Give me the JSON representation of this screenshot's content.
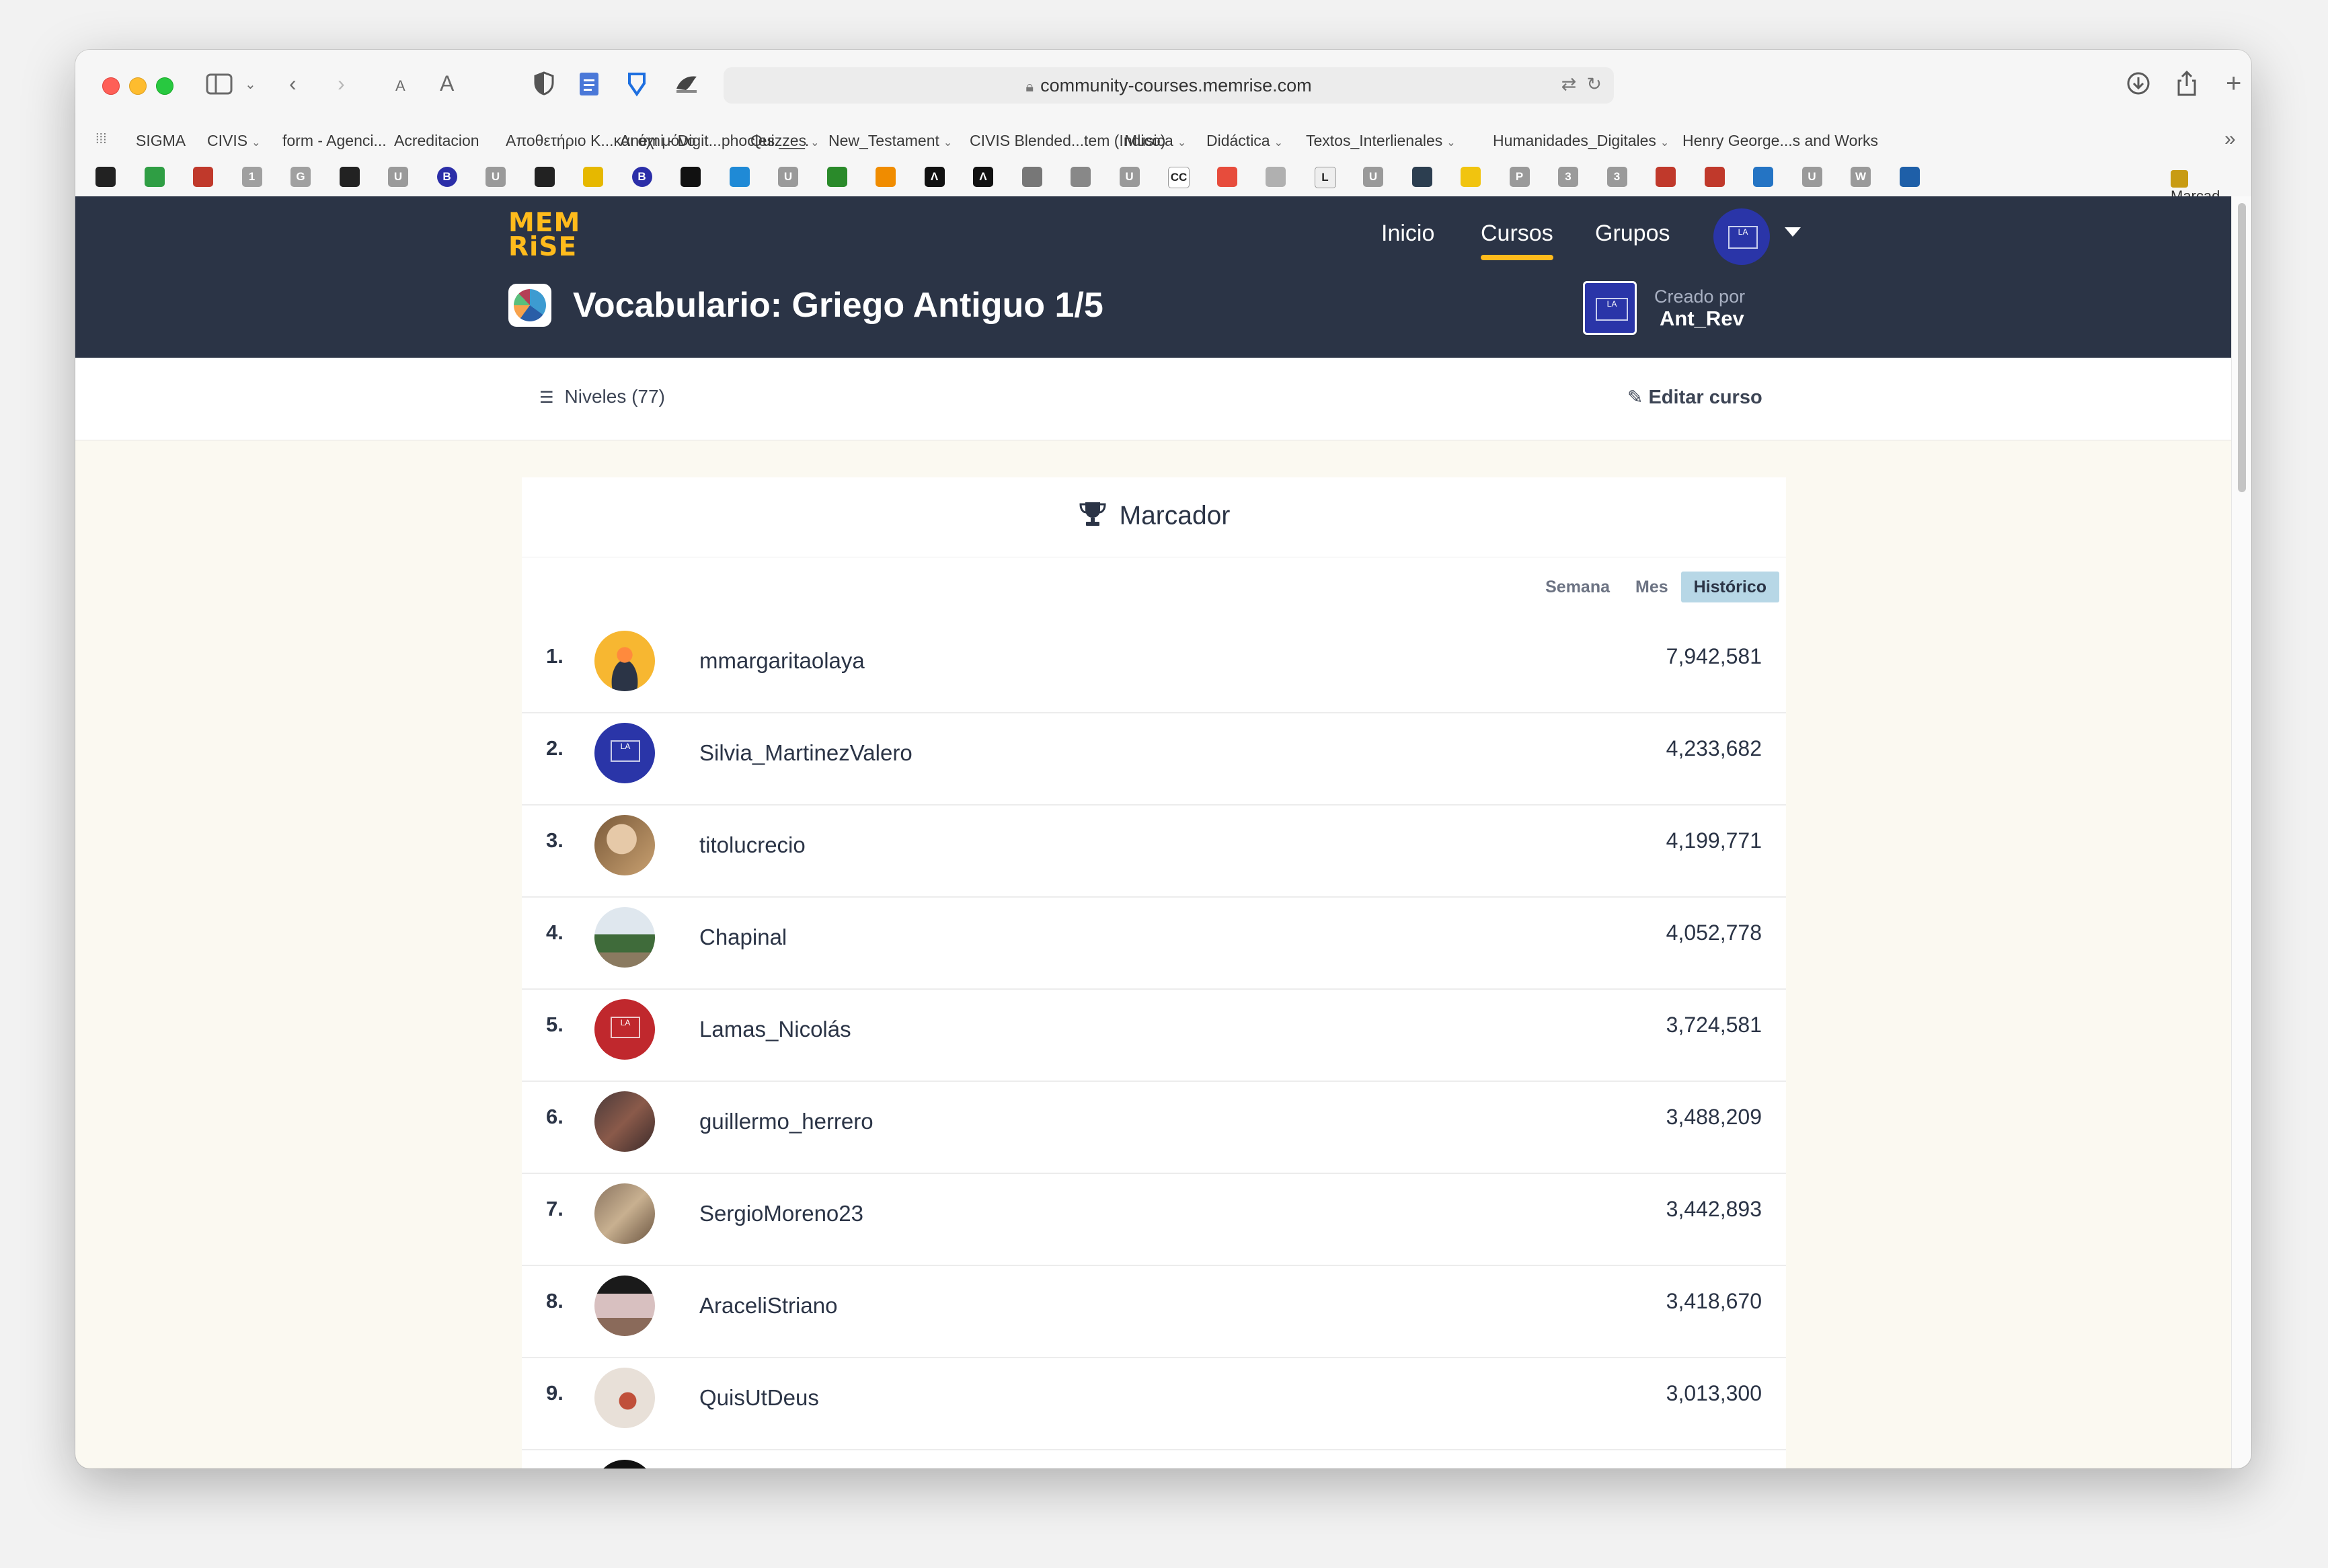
{
  "browser": {
    "url": "community-courses.memrise.com",
    "favorites": [
      {
        "label": "SIGMA",
        "has_menu": false
      },
      {
        "label": "CIVIS",
        "has_menu": true
      },
      {
        "label": "form - Agenci...",
        "has_menu": false
      },
      {
        "label": "Acreditacion",
        "has_menu": false
      },
      {
        "label": "Αποθετήριο Κ...και όχι μόνο",
        "has_menu": false
      },
      {
        "label": "Anemi - Digit...phocles ___.",
        "has_menu": false
      },
      {
        "label": "Quizzes",
        "has_menu": true
      },
      {
        "label": "New_Testament",
        "has_menu": true
      },
      {
        "label": "CIVIS Blended...tem (Indico)",
        "has_menu": false
      },
      {
        "label": "Musica",
        "has_menu": true
      },
      {
        "label": "Didáctica",
        "has_menu": true
      },
      {
        "label": "Textos_Interlienales",
        "has_menu": true
      },
      {
        "label": "Humanidades_Digitales",
        "has_menu": true
      },
      {
        "label": "Henry George...s and Works",
        "has_menu": false
      }
    ],
    "icon_bookmarks": [
      "1",
      "G",
      "U",
      "B",
      "U",
      "B",
      "U",
      "Λ",
      "Λ",
      "U",
      "CC",
      "L",
      "U",
      "P",
      "3",
      "3",
      "U",
      "W"
    ],
    "last_bookmark": "Marcad..."
  },
  "nav": {
    "logo_line1": "MEM",
    "logo_line2": "RiSE",
    "items": [
      "Inicio",
      "Cursos",
      "Grupos"
    ],
    "active": "Cursos",
    "avatar_text": "LA"
  },
  "course": {
    "title": "Vocabulario: Griego Antiguo 1/5",
    "created_by_label": "Creado por",
    "creator": "Ant_Rev",
    "creator_avatar_text": "LA"
  },
  "subnav": {
    "levels": "Niveles (77)",
    "edit": "Editar curso"
  },
  "leaderboard": {
    "title": "Marcador",
    "tabs": [
      "Semana",
      "Mes",
      "Histórico"
    ],
    "active_tab": "Histórico",
    "entries": [
      {
        "rank": "1.",
        "name": "mmargaritaolaya",
        "score": "7,942,581"
      },
      {
        "rank": "2.",
        "name": "Silvia_MartinezValero",
        "score": "4,233,682"
      },
      {
        "rank": "3.",
        "name": "titolucrecio",
        "score": "4,199,771"
      },
      {
        "rank": "4.",
        "name": "Chapinal",
        "score": "4,052,778"
      },
      {
        "rank": "5.",
        "name": "Lamas_Nicolás",
        "score": "3,724,581"
      },
      {
        "rank": "6.",
        "name": "guillermo_herrero",
        "score": "3,488,209"
      },
      {
        "rank": "7.",
        "name": "SergioMoreno23",
        "score": "3,442,893"
      },
      {
        "rank": "8.",
        "name": "AraceliStriano",
        "score": "3,418,670"
      },
      {
        "rank": "9.",
        "name": "QuisUtDeus",
        "score": "3,013,300"
      }
    ],
    "avatar_badge_text": "LA"
  },
  "colors": {
    "header_bg": "#2b3446",
    "accent": "#ffbb1c",
    "page_bg": "#fbf9f1",
    "active_tab_bg": "#b7d7e6"
  }
}
